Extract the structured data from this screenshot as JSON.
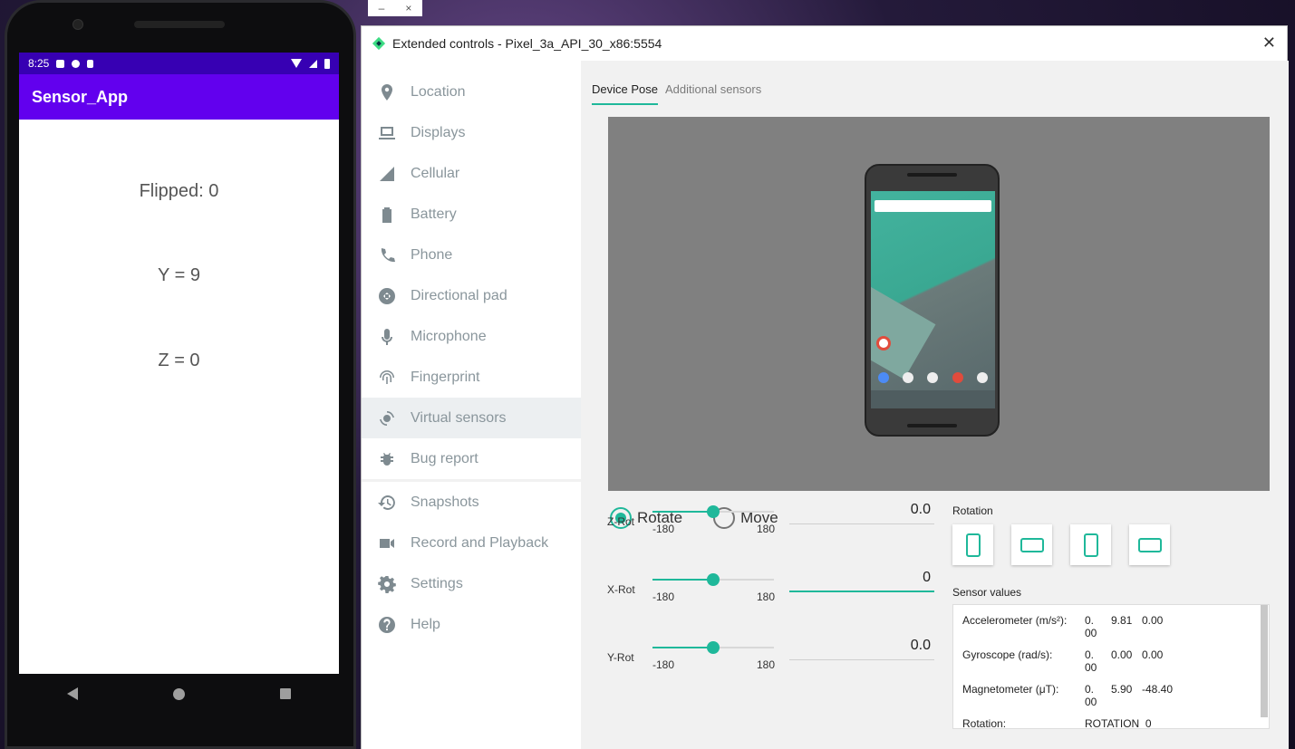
{
  "phone": {
    "time": "8:25",
    "app_title": "Sensor_App",
    "flipped_text": "Flipped:  0",
    "y_text": "Y = 9",
    "z_text": "Z = 0"
  },
  "emulator_toolbar": {
    "minimize": "–",
    "close": "×"
  },
  "window": {
    "title": "Extended controls - Pixel_3a_API_30_x86:5554",
    "close": "✕"
  },
  "sidebar": {
    "items": [
      {
        "label": "Location",
        "icon": "location-icon"
      },
      {
        "label": "Displays",
        "icon": "display-icon"
      },
      {
        "label": "Cellular",
        "icon": "cellular-icon"
      },
      {
        "label": "Battery",
        "icon": "battery-icon"
      },
      {
        "label": "Phone",
        "icon": "phone-icon"
      },
      {
        "label": "Directional pad",
        "icon": "dpad-icon"
      },
      {
        "label": "Microphone",
        "icon": "microphone-icon"
      },
      {
        "label": "Fingerprint",
        "icon": "fingerprint-icon"
      },
      {
        "label": "Virtual sensors",
        "icon": "virtual-sensors-icon",
        "selected": true
      },
      {
        "label": "Bug report",
        "icon": "bug-icon"
      },
      {
        "label": "Snapshots",
        "icon": "history-icon"
      },
      {
        "label": "Record and Playback",
        "icon": "videocam-icon"
      },
      {
        "label": "Settings",
        "icon": "gear-icon"
      },
      {
        "label": "Help",
        "icon": "help-icon"
      }
    ]
  },
  "tabs": [
    {
      "label": "Device Pose",
      "active": true
    },
    {
      "label": "Additional sensors",
      "active": false
    }
  ],
  "mode": {
    "rotate": "Rotate",
    "move": "Move",
    "selected": "rotate"
  },
  "sliders": [
    {
      "label": "Z-Rot",
      "min": "-180",
      "max": "180",
      "value": "0.0",
      "min_v": -180,
      "max_v": 180,
      "v": 0
    },
    {
      "label": "X-Rot",
      "min": "-180",
      "max": "180",
      "value": "0",
      "min_v": -180,
      "max_v": 180,
      "v": 0,
      "focused": true
    },
    {
      "label": "Y-Rot",
      "min": "-180",
      "max": "180",
      "value": "0.0",
      "min_v": -180,
      "max_v": 180,
      "v": 0
    }
  ],
  "rotation": {
    "label": "Rotation"
  },
  "sensor_values": {
    "label": "Sensor values",
    "rows": [
      {
        "name": "Accelerometer (m/s²):",
        "a1": "0.",
        "a2": "00",
        "b": "9.81",
        "c": "0.00"
      },
      {
        "name": "Gyroscope (rad/s):",
        "a1": "0.",
        "a2": "00",
        "b": "0.00",
        "c": "0.00"
      },
      {
        "name": "Magnetometer (μT):",
        "a1": "0.",
        "a2": "00",
        "b": "5.90",
        "c": "-48.40"
      },
      {
        "name": "Rotation:",
        "a1": "ROTATION_0",
        "a2": "",
        "b": "",
        "c": ""
      }
    ]
  },
  "colors": {
    "accent": "#1fb89a",
    "app_bar": "#6200ee",
    "status_bar": "#3700b3"
  }
}
